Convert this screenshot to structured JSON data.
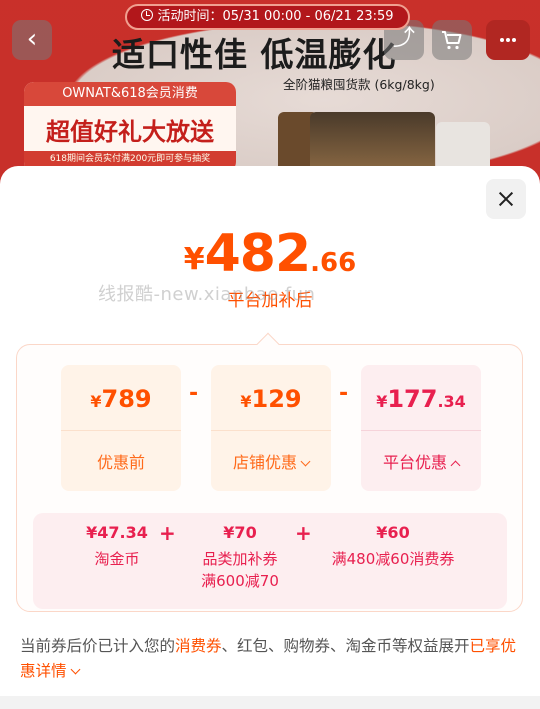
{
  "banner": {
    "activity_time": "活动时间：05/31 00:00 - 06/21 23:59",
    "headline": "适口性佳 低温膨化",
    "sub_headline": "全阶猫粮囤货款 (6kg/8kg)",
    "promo_top": "OWNAT&618会员消费",
    "promo_main": "超值好礼大放送",
    "promo_note": "618期间会员实付满200元即可参与抽奖"
  },
  "price": {
    "currency": "¥",
    "integer": "482",
    "decimal": ".66",
    "label": "平台加补后"
  },
  "watermark": "线报酷-new.xianbao.fun",
  "breakdown": {
    "cells": [
      {
        "currency": "¥",
        "value": "789",
        "decimal": "",
        "label": "优惠前"
      },
      {
        "currency": "¥",
        "value": "129",
        "decimal": "",
        "label": "店铺优惠"
      },
      {
        "currency": "¥",
        "value": "177",
        "decimal": ".34",
        "label": "平台优惠"
      }
    ],
    "operator_minus": "-",
    "operator_plus": "+",
    "platform_items": [
      {
        "amount": "¥47.34",
        "name": "淘金币",
        "name2": ""
      },
      {
        "amount": "¥70",
        "name": "品类加补券",
        "name2": "满600减70"
      },
      {
        "amount": "¥60",
        "name": "满480减60消费券",
        "name2": ""
      }
    ]
  },
  "footnote": {
    "part1": "当前券后价已计入您的",
    "highlight": "消费券",
    "part2": "、红包、购物券、淘金币等权益展开",
    "link": "已享优惠详情"
  },
  "colors": {
    "accent": "#ff5000",
    "platform": "#e8204f"
  }
}
